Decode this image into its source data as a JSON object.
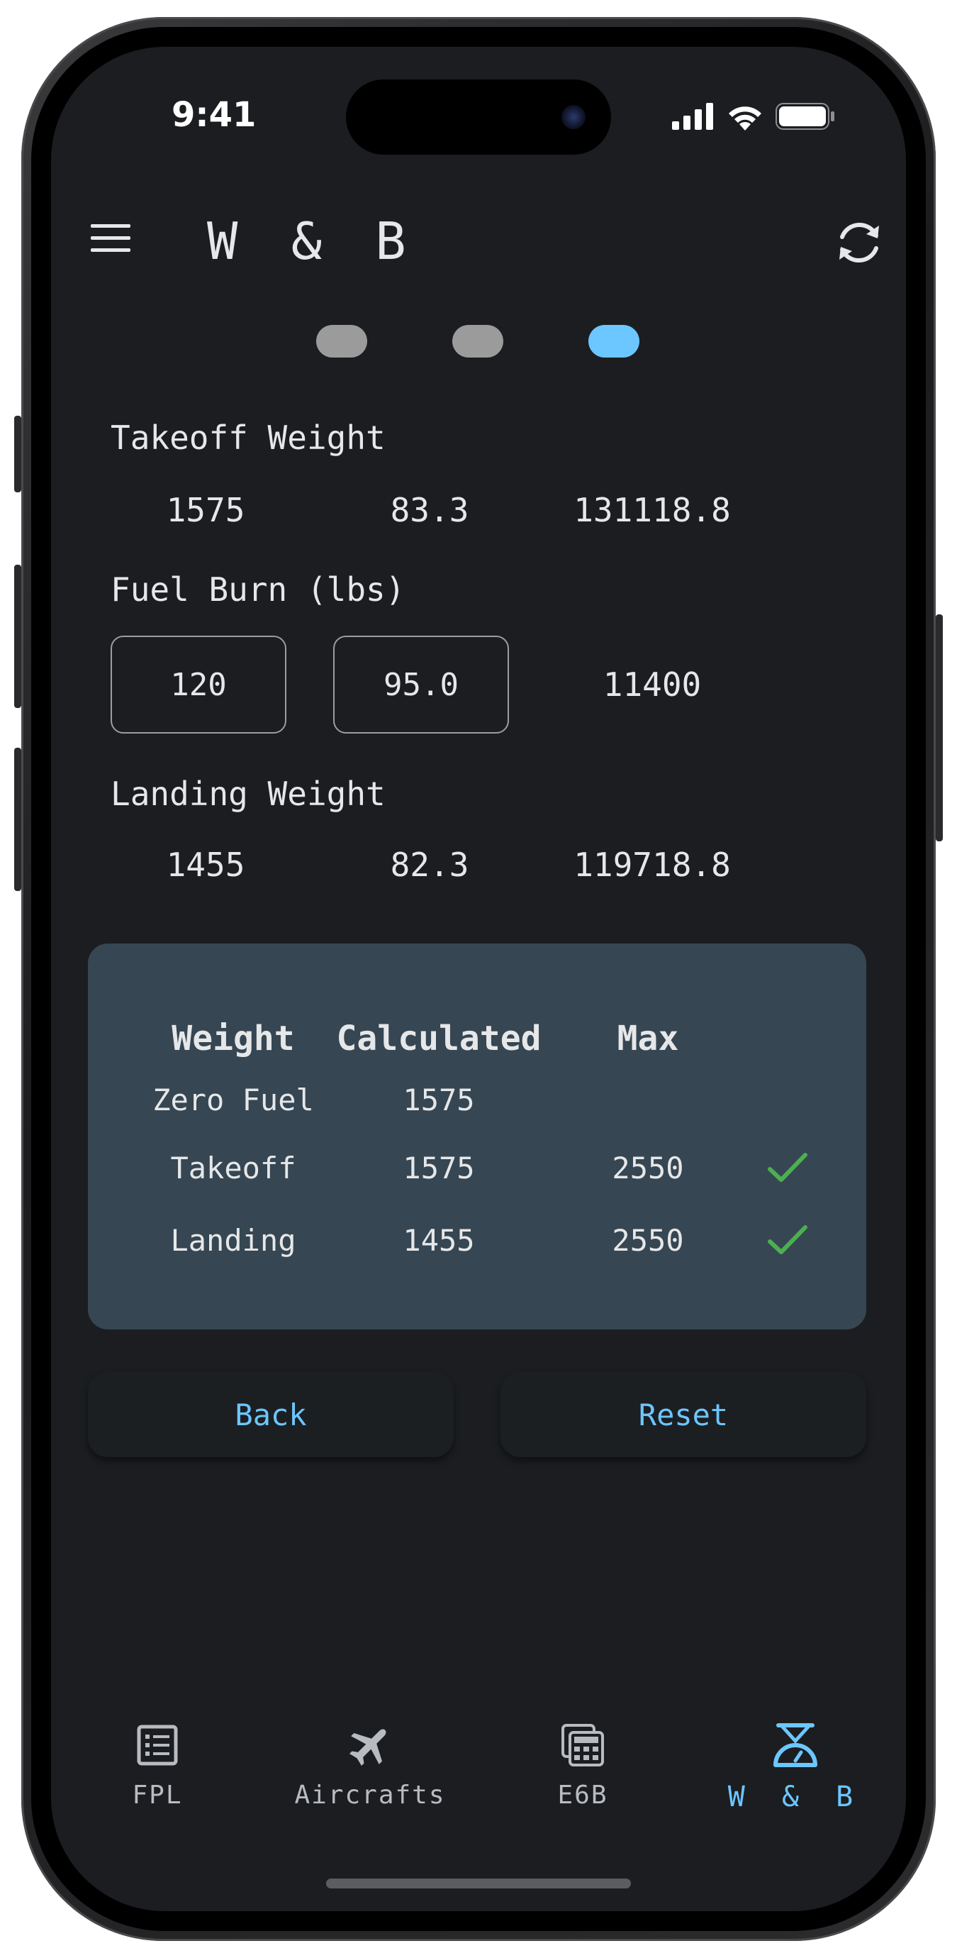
{
  "status_bar": {
    "time": "9:41"
  },
  "header": {
    "title": "W & B"
  },
  "pager": {
    "count": 3,
    "active_index": 2
  },
  "takeoff": {
    "label": "Takeoff Weight",
    "weight": "1575",
    "arm": "83.3",
    "moment": "131118.8"
  },
  "fuel_burn": {
    "label": "Fuel Burn (lbs)",
    "weight": "120",
    "arm": "95.0",
    "moment": "11400"
  },
  "landing": {
    "label": "Landing Weight",
    "weight": "1455",
    "arm": "82.3",
    "moment": "119718.8"
  },
  "summary": {
    "headers": {
      "weight": "Weight",
      "calculated": "Calculated",
      "max": "Max"
    },
    "rows": [
      {
        "name": "Zero Fuel",
        "calculated": "1575",
        "max": "",
        "ok": null
      },
      {
        "name": "Takeoff",
        "calculated": "1575",
        "max": "2550",
        "ok": true
      },
      {
        "name": "Landing",
        "calculated": "1455",
        "max": "2550",
        "ok": true
      }
    ]
  },
  "actions": {
    "back": "Back",
    "reset": "Reset"
  },
  "nav": {
    "items": [
      {
        "label": "FPL",
        "icon": "list-icon"
      },
      {
        "label": "Aircrafts",
        "icon": "airplane-icon"
      },
      {
        "label": "E6B",
        "icon": "calculator-icon"
      },
      {
        "label": "W & B",
        "icon": "scale-icon"
      }
    ],
    "active_index": 3
  },
  "colors": {
    "background": "#1b1d20",
    "card": "#364653",
    "accent": "#6cc6ff",
    "check": "#4caf50",
    "dot_inactive": "#9b9b9b"
  }
}
